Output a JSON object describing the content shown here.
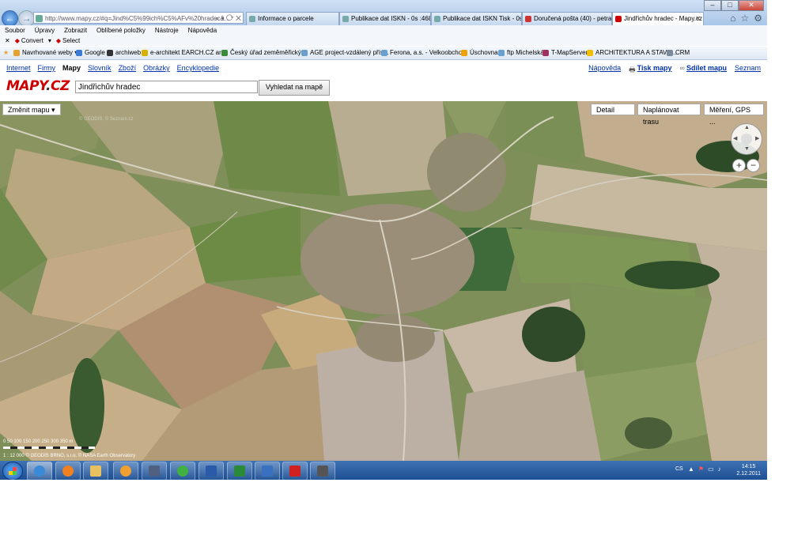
{
  "browser": {
    "address": "http://www.mapy.cz/#q=Jind%C5%99ich%C5%AFv%20hradec&...",
    "tabs": [
      {
        "label": "Informace o parcele"
      },
      {
        "label": "Publikace dat ISKN - 0s :468ms..."
      },
      {
        "label": "Publikace dat ISKN Tisk - 0s :84..."
      },
      {
        "label": "Doručená pošta (40) - petra.m..."
      },
      {
        "label": "Jindřichův hradec - Mapy.cz"
      }
    ],
    "menu": [
      "Soubor",
      "Úpravy",
      "Zobrazit",
      "Oblíbené položky",
      "Nástroje",
      "Nápověda"
    ],
    "cmd": {
      "convert": "Convert",
      "select": "Select"
    },
    "favorites": [
      {
        "label": "Navrhované weby",
        "color": "#e8a030"
      },
      {
        "label": "Google",
        "color": "#3a7bd5"
      },
      {
        "label": "archiweb",
        "color": "#333333"
      },
      {
        "label": "e-architekt  EARCH.CZ  ar...",
        "color": "#d8b000"
      },
      {
        "label": "Český úřad zeměměřický ...",
        "color": "#3a8a3a"
      },
      {
        "label": "AGE project-vzdálený přís...",
        "color": "#6aa0d0"
      },
      {
        "label": "Ferona, a.s. - Velkoobcho...",
        "color": "#6aa0d0"
      },
      {
        "label": "Úschovna",
        "color": "#f0a000"
      },
      {
        "label": "ftp Michelská",
        "color": "#6aa0d0"
      },
      {
        "label": "T-MapServer",
        "color": "#a03060"
      },
      {
        "label": "ARCHITEKTURA A STAVE...",
        "color": "#f0c000"
      },
      {
        "label": "CRM",
        "color": "#7a8a9a"
      }
    ]
  },
  "site": {
    "nav": [
      "Internet",
      "Firmy",
      "Mapy",
      "Slovník",
      "Zboží",
      "Obrázky",
      "Encyklopedie"
    ],
    "right_nav": {
      "help": "Nápověda",
      "print": "Tisk mapy",
      "share": "Sdílet mapu",
      "seznam": "Seznam"
    },
    "logo": "MAPY.CZ",
    "search_value": "Jindřichův hradec",
    "search_button": "Vyhledat na mapě"
  },
  "map": {
    "change_map": "Změnit mapu",
    "detail": "Detail",
    "route": "Naplánovat trasu",
    "measure": "Měření, GPS ...",
    "watermark": "© GEODIS, © Seznam.cz",
    "scale_text": "0  50  100  150  200  250  300  350 m",
    "copyright": "1 : 12 000  © GEODIS BRNO, s.r.o. © NASA Earth Observatory"
  },
  "taskbar": {
    "lang": "CS",
    "time": "14:15",
    "date": "2.12.2011"
  }
}
